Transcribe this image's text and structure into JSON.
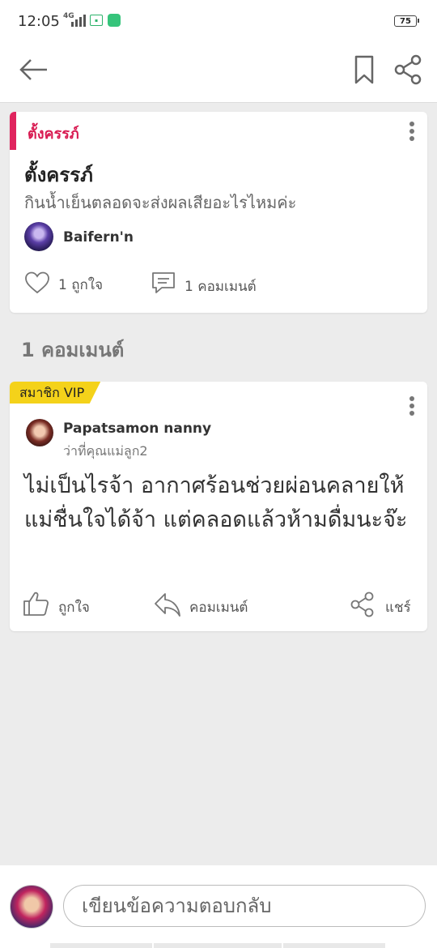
{
  "status_bar": {
    "time": "12:05",
    "network": "4G",
    "battery": "75"
  },
  "post": {
    "category": "ตั้งครรภ์",
    "title": "ตั้งครรภ์",
    "body": "กินน้ำเย็นตลอดจะส่งผลเสียอะไรไหมค่ะ",
    "author": "Baifern'n",
    "likes_label": "1 ถูกใจ",
    "comments_label": "1 คอมเมนต์"
  },
  "comments_heading": "1 คอมเมนต์",
  "comment": {
    "badge": "สมาชิก VIP",
    "author": "Papatsamon nanny",
    "subtitle": "ว่าที่คุณแม่ลูก2",
    "body": "ไม่เป็นไรจ้า อากาศร้อนช่วยผ่อนคลายให้แม่ชื่นใจได้จ้า แต่คลอดแล้วห้ามดื่มนะจ๊ะ",
    "like_label": "ถูกใจ",
    "comment_label": "คอมเมนต์",
    "share_label": "แชร์"
  },
  "composer": {
    "placeholder": "เขียนข้อความตอบกลับ"
  },
  "colors": {
    "accent": "#e0245e",
    "vip": "#f4d21a"
  }
}
